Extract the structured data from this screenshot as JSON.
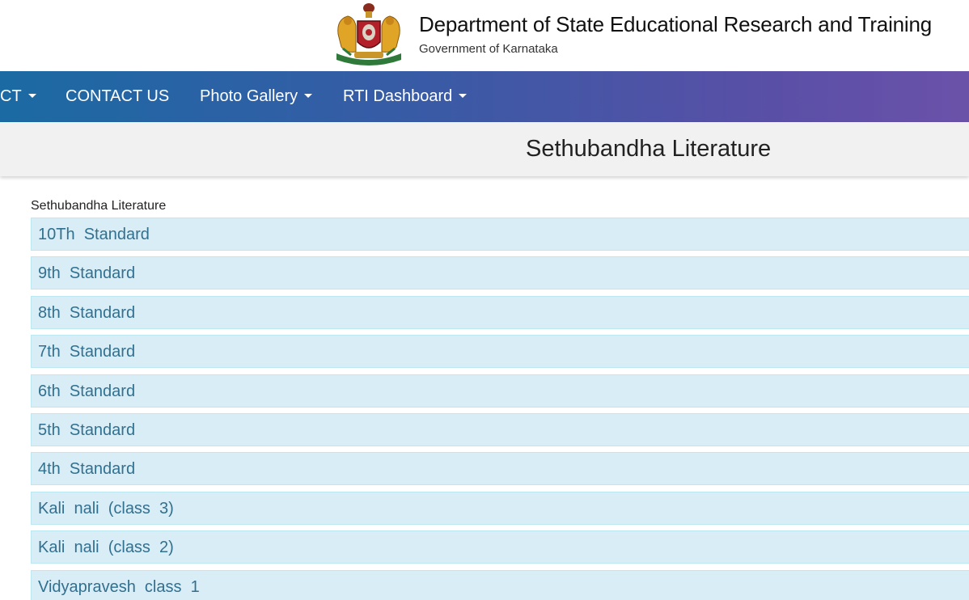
{
  "header": {
    "title": "Department of State Educational Research and Training",
    "subtitle": "Government of Karnataka",
    "emblem_icon": "karnataka-emblem-icon"
  },
  "navbar": {
    "items": [
      {
        "label": "CT",
        "has_caret": true
      },
      {
        "label": "CONTACT US",
        "has_caret": false
      },
      {
        "label": "Photo Gallery",
        "has_caret": true
      },
      {
        "label": "RTI Dashboard",
        "has_caret": true
      }
    ]
  },
  "page_title": "Sethubandha Literature",
  "section": {
    "label": "Sethubandha Literature",
    "items": [
      "10Th  Standard",
      "9th  Standard",
      "8th  Standard",
      "7th  Standard",
      "6th  Standard",
      "5th  Standard",
      "4th  Standard",
      "Kali  nali  (class  3)",
      "Kali  nali  (class  2)",
      "Vidyapravesh  class  1"
    ]
  },
  "colors": {
    "nav_gradient_start": "#1b6aa4",
    "nav_gradient_end": "#6b52a9",
    "list_item_bg": "#d9edf7",
    "list_item_text": "#31708f",
    "title_band_bg": "#f1f1f1"
  }
}
